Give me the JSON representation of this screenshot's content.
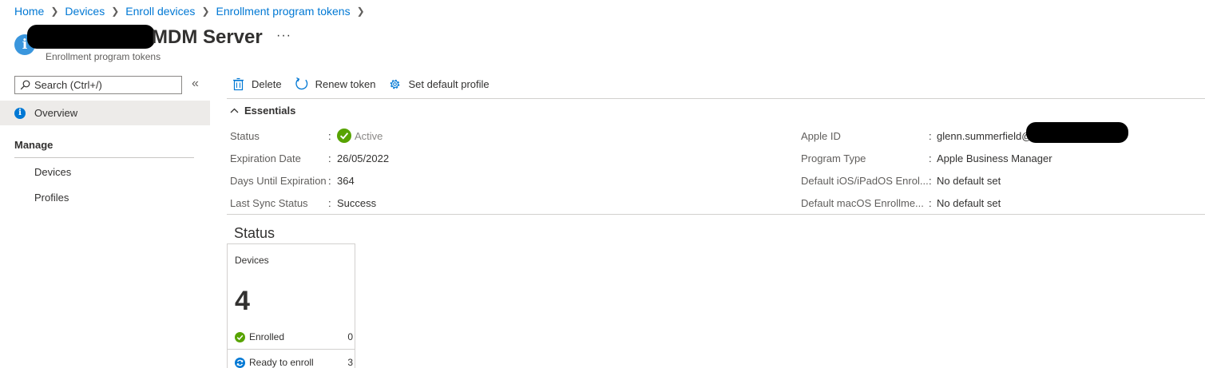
{
  "breadcrumb": {
    "items": [
      "Home",
      "Devices",
      "Enroll devices",
      "Enrollment program tokens"
    ]
  },
  "header": {
    "title": "MDM Server",
    "more_label": "···",
    "subtitle": "Enrollment program tokens",
    "icon": "info-icon"
  },
  "sidebar": {
    "search_placeholder": "Search (Ctrl+/)",
    "collapse_label": "«",
    "overview_label": "Overview",
    "section_label": "Manage",
    "items": [
      "Devices",
      "Profiles"
    ]
  },
  "toolbar": {
    "delete_label": "Delete",
    "renew_label": "Renew token",
    "default_profile_label": "Set default profile"
  },
  "essentials": {
    "header_label": "Essentials",
    "left": [
      {
        "label": "Status",
        "value": "Active"
      },
      {
        "label": "Expiration Date",
        "value": "26/05/2022"
      },
      {
        "label": "Days Until Expiration",
        "value": "364"
      },
      {
        "label": "Last Sync Status",
        "value": "Success"
      }
    ],
    "right": [
      {
        "label": "Apple ID",
        "value": "glenn.summerfield@"
      },
      {
        "label": "Program Type",
        "value": "Apple Business Manager"
      },
      {
        "label": "Default iOS/iPadOS Enrol...",
        "value": "No default set"
      },
      {
        "label": "Default macOS Enrollme...",
        "value": "No default set"
      }
    ],
    "colon": ":"
  },
  "status": {
    "heading": "Status",
    "tile": {
      "title": "Devices",
      "count": "4",
      "rows": [
        {
          "label": "Enrolled",
          "value": "0"
        },
        {
          "label": "Ready to enroll",
          "value": "3"
        }
      ]
    }
  },
  "colors": {
    "accent": "#0078d4",
    "success": "#57a300",
    "nav_selected": "#edebe9"
  }
}
